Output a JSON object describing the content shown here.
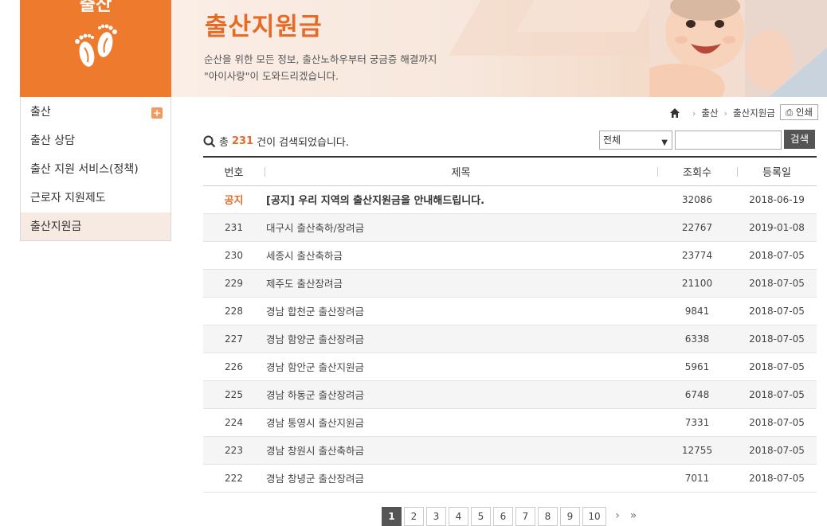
{
  "sidebar": {
    "title": "출산",
    "menu": [
      {
        "label": "출산",
        "active": false
      },
      {
        "label": "출산 상담",
        "active": false
      },
      {
        "label": "출산 지원 서비스(정책)",
        "active": false
      },
      {
        "label": "근로자 지원제도",
        "active": false
      },
      {
        "label": "출산지원금",
        "active": true
      }
    ]
  },
  "banner": {
    "title": "출산지원금",
    "desc_line1": "순산을 위한 모든 정보, 출산노하우부터 궁금증 해결까지",
    "desc_line2": "\"아이사랑\"이 도와드리겠습니다."
  },
  "breadcrumb": {
    "items": [
      "출산",
      "출산지원금"
    ],
    "print_label": "인쇄"
  },
  "search": {
    "prefix": "총",
    "count": "231",
    "suffix": "건이 검색되었습니다.",
    "select_value": "전체",
    "input_value": "",
    "button_label": "검색"
  },
  "table": {
    "headers": {
      "no": "번호",
      "subject": "제목",
      "views": "조회수",
      "date": "등록일"
    },
    "rows": [
      {
        "no": "공지",
        "subject": "[공지] 우리 지역의 출산지원금을 안내해드립니다.",
        "views": "32086",
        "date": "2018-06-19"
      },
      {
        "no": "231",
        "subject": "대구시 출산축하/장려금",
        "views": "22767",
        "date": "2019-01-08"
      },
      {
        "no": "230",
        "subject": "세종시 출산축하금",
        "views": "23774",
        "date": "2018-07-05"
      },
      {
        "no": "229",
        "subject": "제주도 출산장려금",
        "views": "21100",
        "date": "2018-07-05"
      },
      {
        "no": "228",
        "subject": "경남 합천군 출산장려금",
        "views": "9841",
        "date": "2018-07-05"
      },
      {
        "no": "227",
        "subject": "경남 함양군 출산장려금",
        "views": "6338",
        "date": "2018-07-05"
      },
      {
        "no": "226",
        "subject": "경남 함안군 출산지원금",
        "views": "5961",
        "date": "2018-07-05"
      },
      {
        "no": "225",
        "subject": "경남 하동군 출산장려금",
        "views": "6748",
        "date": "2018-07-05"
      },
      {
        "no": "224",
        "subject": "경남 통영시 출산지원금",
        "views": "7331",
        "date": "2018-07-05"
      },
      {
        "no": "223",
        "subject": "경남 창원시 출산축하금",
        "views": "12755",
        "date": "2018-07-05"
      },
      {
        "no": "222",
        "subject": "경남 창녕군 출산장려금",
        "views": "7011",
        "date": "2018-07-05"
      }
    ]
  },
  "pagination": {
    "pages": [
      "1",
      "2",
      "3",
      "4",
      "5",
      "6",
      "7",
      "8",
      "9",
      "10"
    ],
    "current": "1",
    "next": "›",
    "last": "»"
  },
  "colors": {
    "accent": "#ee7a2d",
    "text_accent": "#e56b27"
  }
}
